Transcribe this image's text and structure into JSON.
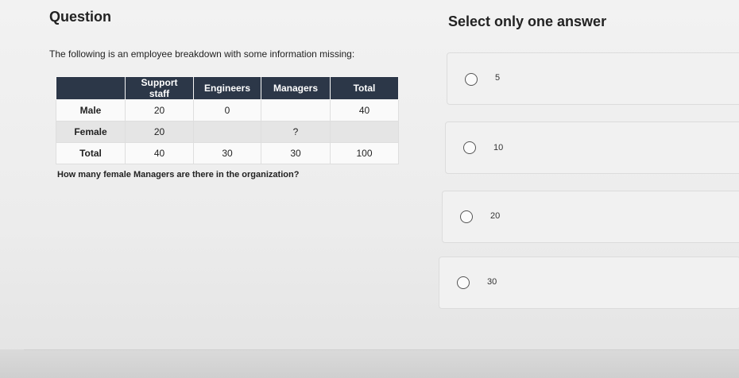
{
  "question": {
    "title": "Question",
    "intro": "The following is an employee breakdown with some information missing:",
    "prompt": "How many female Managers are there in the organization?"
  },
  "table": {
    "headers": [
      "",
      "Support staff",
      "Engineers",
      "Managers",
      "Total"
    ],
    "rows": [
      [
        "Male",
        "20",
        "0",
        "",
        "40"
      ],
      [
        "Female",
        "20",
        "",
        "?",
        ""
      ],
      [
        "Total",
        "40",
        "30",
        "30",
        "100"
      ]
    ]
  },
  "answers": {
    "title": "Select only one answer",
    "options": [
      {
        "label": "5"
      },
      {
        "label": "10"
      },
      {
        "label": "20"
      },
      {
        "label": "30"
      }
    ]
  }
}
